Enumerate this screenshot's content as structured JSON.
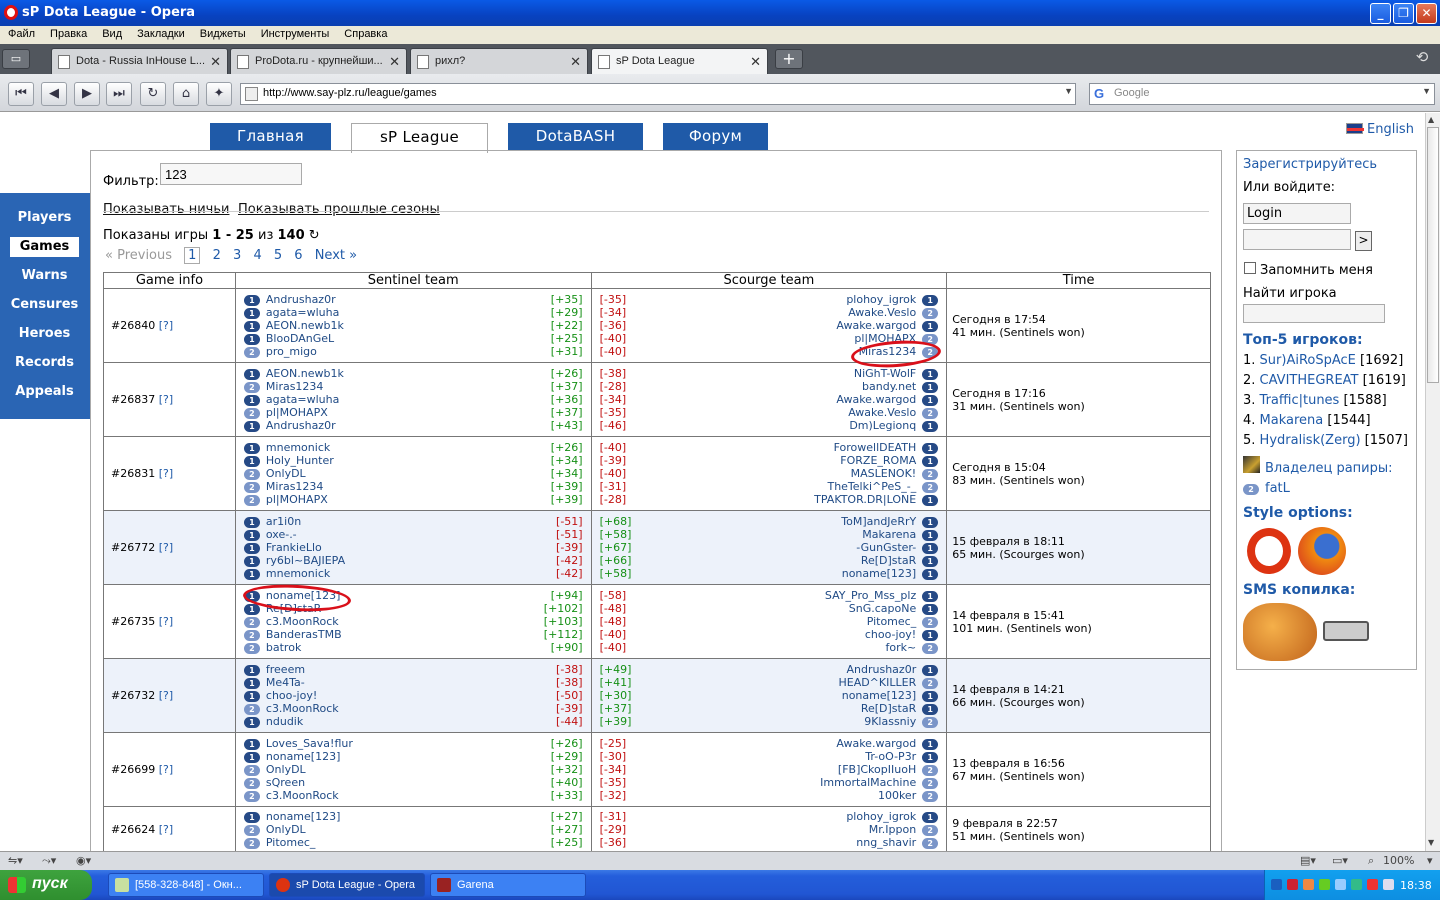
{
  "window": {
    "title": "sP Dota League - Opera"
  },
  "menu": [
    "Файл",
    "Правка",
    "Вид",
    "Закладки",
    "Виджеты",
    "Инструменты",
    "Справка"
  ],
  "browser_tabs": [
    {
      "label": "Dota - Russia InHouse L..."
    },
    {
      "label": "ProDota.ru - крупнейши..."
    },
    {
      "label": "рихл?"
    },
    {
      "label": "sP Dota League"
    }
  ],
  "address": {
    "url": "http://www.say-plz.ru/league/games",
    "search_placeholder": "Google"
  },
  "site_tabs": [
    "Главная",
    "sP League",
    "DotaBASH",
    "Форум"
  ],
  "language": "English",
  "left_nav": [
    "Players",
    "Games",
    "Warns",
    "Censures",
    "Heroes",
    "Records",
    "Appeals"
  ],
  "filter": {
    "label": "Фильтр:",
    "value": "123"
  },
  "links": {
    "draws": "Показывать ничьи",
    "past": "Показывать прошлые сезоны"
  },
  "shown": {
    "prefix": "Показаны игры",
    "range": "1 - 25",
    "of": "из",
    "total": "140",
    "refresh": "↻"
  },
  "pager": {
    "prev": "« Previous",
    "pages": [
      "1",
      "2",
      "3",
      "4",
      "5",
      "6"
    ],
    "next": "Next »"
  },
  "columns": [
    "Game info",
    "Sentinel team",
    "Scourge team",
    "Time"
  ],
  "games": [
    {
      "id": "#26840",
      "q": "[?]",
      "alt": false,
      "sentinel": [
        [
          "1",
          "Andrushaz0r",
          "[+35]"
        ],
        [
          "1",
          "agata=wluha",
          "[+29]"
        ],
        [
          "1",
          "AEON.newb1k",
          "[+22]"
        ],
        [
          "1",
          "BlooDAnGeL",
          "[+25]"
        ],
        [
          "2",
          "pro_migo",
          "[+31]"
        ]
      ],
      "scourge": [
        [
          "[-35]",
          "plohoy_igrok",
          "1"
        ],
        [
          "[-34]",
          "Awake.Veslo",
          "2"
        ],
        [
          "[-36]",
          "Awake.wargod",
          "1"
        ],
        [
          "[-40]",
          "pl|MOHAPX",
          "2"
        ],
        [
          "[-40]",
          "Miras1234",
          "2"
        ]
      ],
      "time": "Сегодня в 17:54",
      "dur": "41 мин. (Sentinels won)"
    },
    {
      "id": "#26837",
      "q": "[?]",
      "alt": false,
      "sentinel": [
        [
          "1",
          "AEON.newb1k",
          "[+26]"
        ],
        [
          "2",
          "Miras1234",
          "[+37]"
        ],
        [
          "1",
          "agata=wluha",
          "[+36]"
        ],
        [
          "2",
          "pl|MOHAPX",
          "[+37]"
        ],
        [
          "1",
          "Andrushaz0r",
          "[+43]"
        ]
      ],
      "scourge": [
        [
          "[-38]",
          "NiGhT-WolF",
          "1"
        ],
        [
          "[-28]",
          "bandy.net",
          "1"
        ],
        [
          "[-34]",
          "Awake.wargod",
          "1"
        ],
        [
          "[-35]",
          "Awake.Veslo",
          "2"
        ],
        [
          "[-46]",
          "Dm)Legionq",
          "1"
        ]
      ],
      "time": "Сегодня в 17:16",
      "dur": "31 мин. (Sentinels won)"
    },
    {
      "id": "#26831",
      "q": "[?]",
      "alt": false,
      "sentinel": [
        [
          "1",
          "mnemonick",
          "[+26]"
        ],
        [
          "1",
          "Holy_Hunter",
          "[+34]"
        ],
        [
          "2",
          "OnlyDL",
          "[+34]"
        ],
        [
          "2",
          "Miras1234",
          "[+39]"
        ],
        [
          "2",
          "pl|MOHAPX",
          "[+39]"
        ]
      ],
      "scourge": [
        [
          "[-40]",
          "ForowellDEATH",
          "1"
        ],
        [
          "[-39]",
          "FORZE_ROMA",
          "1"
        ],
        [
          "[-40]",
          "MASLENOK!",
          "2"
        ],
        [
          "[-31]",
          "TheTelki^PeS_-_",
          "2"
        ],
        [
          "[-28]",
          "TPAKTOR.DR|LONE",
          "1"
        ]
      ],
      "time": "Сегодня в 15:04",
      "dur": "83 мин. (Sentinels won)"
    },
    {
      "id": "#26772",
      "q": "[?]",
      "alt": true,
      "sentinel": [
        [
          "1",
          "ar1i0n",
          "[-51]"
        ],
        [
          "1",
          "oxe-.-",
          "[-51]"
        ],
        [
          "1",
          "FrankieLlo",
          "[-39]"
        ],
        [
          "1",
          "ry6bl~BAJIEPA",
          "[-42]"
        ],
        [
          "1",
          "mnemonick",
          "[-42]"
        ]
      ],
      "scourge": [
        [
          "[+68]",
          "ToM]andJeRrY",
          "1"
        ],
        [
          "[+58]",
          "Makarena",
          "1"
        ],
        [
          "[+67]",
          "-GunGster-",
          "1"
        ],
        [
          "[+66]",
          "Re[D]staR",
          "1"
        ],
        [
          "[+58]",
          "noname[123]",
          "1"
        ]
      ],
      "time": "15 февраля в 18:11",
      "dur": "65 мин. (Scourges won)"
    },
    {
      "id": "#26735",
      "q": "[?]",
      "alt": false,
      "sentinel": [
        [
          "1",
          "noname[123]",
          "[+94]"
        ],
        [
          "1",
          "Re[D]staR",
          "[+102]"
        ],
        [
          "2",
          "c3.MoonRock",
          "[+103]"
        ],
        [
          "2",
          "BanderasTMB",
          "[+112]"
        ],
        [
          "2",
          "batrok",
          "[+90]"
        ]
      ],
      "scourge": [
        [
          "[-58]",
          "SAY_Pro_Mss_plz",
          "1"
        ],
        [
          "[-48]",
          "SnG.capoNe",
          "1"
        ],
        [
          "[-48]",
          "Pitomec_",
          "2"
        ],
        [
          "[-40]",
          "choo-joy!",
          "1"
        ],
        [
          "[-40]",
          "fork~",
          "2"
        ]
      ],
      "time": "14 февраля в 15:41",
      "dur": "101 мин. (Sentinels won)"
    },
    {
      "id": "#26732",
      "q": "[?]",
      "alt": true,
      "sentinel": [
        [
          "1",
          "freeem",
          "[-38]"
        ],
        [
          "1",
          "Me4Ta-",
          "[-38]"
        ],
        [
          "1",
          "choo-joy!",
          "[-50]"
        ],
        [
          "2",
          "c3.MoonRock",
          "[-39]"
        ],
        [
          "1",
          "ndudik",
          "[-44]"
        ]
      ],
      "scourge": [
        [
          "[+49]",
          "Andrushaz0r",
          "1"
        ],
        [
          "[+41]",
          "HEAD^KILLER",
          "2"
        ],
        [
          "[+30]",
          "noname[123]",
          "1"
        ],
        [
          "[+37]",
          "Re[D]staR",
          "1"
        ],
        [
          "[+39]",
          "9Klassniy",
          "2"
        ]
      ],
      "time": "14 февраля в 14:21",
      "dur": "66 мин. (Scourges won)"
    },
    {
      "id": "#26699",
      "q": "[?]",
      "alt": false,
      "sentinel": [
        [
          "1",
          "Loves_Sava!flur",
          "[+26]"
        ],
        [
          "1",
          "noname[123]",
          "[+29]"
        ],
        [
          "2",
          "OnlyDL",
          "[+32]"
        ],
        [
          "2",
          "sQreen",
          "[+40]"
        ],
        [
          "2",
          "c3.MoonRock",
          "[+33]"
        ]
      ],
      "scourge": [
        [
          "[-25]",
          "Awake.wargod",
          "1"
        ],
        [
          "[-30]",
          "Tr-oO-P3r",
          "1"
        ],
        [
          "[-34]",
          "[FB]CkopIIuoH",
          "2"
        ],
        [
          "[-35]",
          "ImmortalMachine",
          "2"
        ],
        [
          "[-32]",
          "100ker",
          "2"
        ]
      ],
      "time": "13 февраля в 16:56",
      "dur": "67 мин. (Sentinels won)"
    },
    {
      "id": "#26624",
      "q": "[?]",
      "alt": false,
      "sentinel": [
        [
          "1",
          "noname[123]",
          "[+27]"
        ],
        [
          "2",
          "OnlyDL",
          "[+27]"
        ],
        [
          "2",
          "Pitomec_",
          "[+25]"
        ]
      ],
      "scourge": [
        [
          "[-31]",
          "plohoy_igrok",
          "1"
        ],
        [
          "[-29]",
          "Mr.Ippon",
          "2"
        ],
        [
          "[-36]",
          "nng_shavir",
          "2"
        ]
      ],
      "time": "9 февраля в 22:57",
      "dur": "51 мин. (Sentinels won)"
    }
  ],
  "sidebar": {
    "register": "Зарегистрируйтесь",
    "or_login": "Или войдите:",
    "login_value": "Login",
    "go": ">",
    "remember": "Запомнить меня",
    "find_player": "Найти игрока",
    "top5_title": "Топ-5 игроков:",
    "top5": [
      [
        "1.",
        "Sur)AiRoSpAcE",
        "[1692]"
      ],
      [
        "2.",
        "CAVITHEGREAT",
        "[1619]"
      ],
      [
        "3.",
        "Traffic|tunes",
        "[1588]"
      ],
      [
        "4.",
        "Makarena",
        "[1544]"
      ],
      [
        "5.",
        "Hydralisk(Zerg)",
        "[1507]"
      ]
    ],
    "rapier_owner": "Владелец рапиры:",
    "rapier_badge": "2",
    "rapier_name": "fatL",
    "style_options": "Style options:",
    "sms": "SMS копилка:"
  },
  "statusbar": {
    "zoom": "100%"
  },
  "taskbar": {
    "start": "пуск",
    "tasks": [
      "[558-328-848] - Окн...",
      "sP Dota League - Opera",
      "Garena"
    ],
    "clock": "18:38"
  },
  "colors": {
    "accent": "#1f5aa8",
    "nav": "#2a65b4",
    "positive": "#169016",
    "negative": "#c01010",
    "annotation": "#d9101a"
  }
}
